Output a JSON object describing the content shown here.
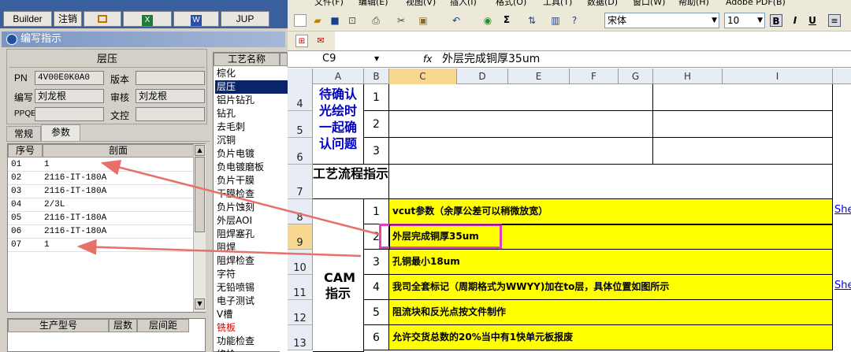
{
  "left_app": {
    "toolbar": {
      "builder_label": "Builder",
      "logout_label": "注销",
      "jup_label": "JUP"
    },
    "window_title": "编写指示",
    "group_title": "层压",
    "fields": {
      "pn_label": "PN",
      "pn_value": "4V00E0K0A0",
      "version_label": "版本",
      "version_value": "",
      "author_label": "编写",
      "author_value": "刘龙根",
      "reviewer_label": "审核",
      "reviewer_value": "刘龙根",
      "ppqe_label": "PPQE",
      "ppqe_value": "",
      "wenzheng_label": "文控",
      "wenzheng_value": ""
    },
    "tabs": [
      "常规",
      "参数"
    ],
    "grid": {
      "headers": [
        "序号",
        "剖面"
      ],
      "rows": [
        [
          "01",
          "1"
        ],
        [
          "02",
          "2116-IT-180A"
        ],
        [
          "03",
          "2116-IT-180A"
        ],
        [
          "04",
          "2/3L"
        ],
        [
          "05",
          "2116-IT-180A"
        ],
        [
          "06",
          "2116-IT-180A"
        ],
        [
          "07",
          "1"
        ]
      ]
    },
    "grid2_headers": [
      "生产型号",
      "层数",
      "层间距"
    ],
    "process_list": {
      "header": "工艺名称",
      "items": [
        "棕化",
        "层压",
        "铝片钻孔",
        "钻孔",
        "去毛刺",
        "沉铜",
        "负片电镀",
        "负电镀磨板",
        "负片干膜",
        "干膜检查",
        "负片蚀刻",
        "外层AOI",
        "阻焊塞孔",
        "阻焊",
        "阻焊检查",
        "字符",
        "无铅喷锡",
        "电子测试",
        "V槽",
        "铣板",
        "功能检查",
        "终检"
      ],
      "selected_index": 1,
      "red_index": 19
    }
  },
  "excel": {
    "menu": [
      "文件(F)",
      "编辑(E)",
      "视图(V)",
      "插入(I)",
      "格式(O)",
      "工具(T)",
      "数据(D)",
      "窗口(W)",
      "帮助(H)",
      "Adobe PDF(B)"
    ],
    "font_name": "宋体",
    "font_size": "10",
    "bold_label": "B",
    "italic_label": "I",
    "underline_label": "U",
    "sigma_label": "Σ",
    "name_box": "C9",
    "fx_label": "fx",
    "formula": "外层完成铜厚35um",
    "columns": [
      "A",
      "B",
      "C",
      "D",
      "E",
      "F",
      "G",
      "H",
      "I"
    ],
    "row_numbers": [
      "4",
      "5",
      "6",
      "7",
      "8",
      "9",
      "10",
      "11",
      "12",
      "13"
    ],
    "confirm_block": "待确认光绘时一起确认问题",
    "confirm_nums": [
      "1",
      "2",
      "3"
    ],
    "flow_label": "工艺流程指示",
    "cam_label": "CAM指示",
    "steps": [
      {
        "no": "1",
        "text": "vcut参数（余厚公差可以稍微放宽）"
      },
      {
        "no": "2",
        "text": "外层完成铜厚35um"
      },
      {
        "no": "3",
        "text": "孔铜最小18um"
      },
      {
        "no": "4",
        "text": "我司全套标记（周期格式为WWYY)加在to层，具体位置如图所示"
      },
      {
        "no": "5",
        "text": "阻流块和反光点按文件制作"
      },
      {
        "no": "6",
        "text": "允许交货总数的20%当中有1快单元板报废"
      }
    ],
    "link_text": "She",
    "highlight_color": "#ffff00",
    "callout_color": "#e040c0"
  }
}
